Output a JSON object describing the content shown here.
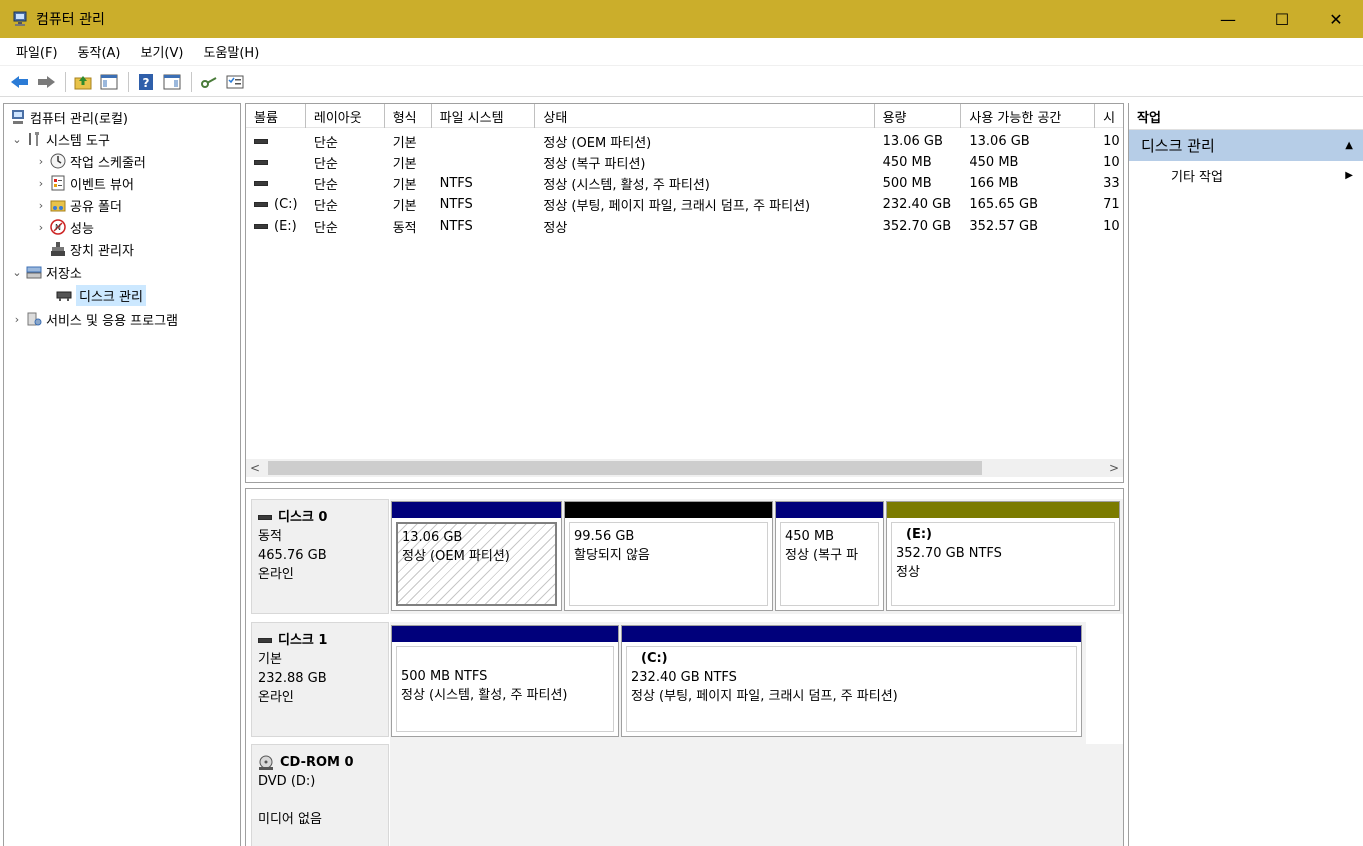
{
  "window": {
    "title": "컴퓨터 관리",
    "minimize": "—",
    "maximize": "☐",
    "close": "✕"
  },
  "menu": [
    "파일(F)",
    "동작(A)",
    "보기(V)",
    "도움말(H)"
  ],
  "tree": {
    "root": "컴퓨터 관리(로컬)",
    "system_tools": "시스템 도구",
    "task_scheduler": "작업 스케줄러",
    "event_viewer": "이벤트 뷰어",
    "shared_folders": "공유 폴더",
    "performance": "성능",
    "device_manager": "장치 관리자",
    "storage": "저장소",
    "disk_management": "디스크 관리",
    "services_apps": "서비스 및 응용 프로그램"
  },
  "volumes": {
    "columns": [
      "볼륨",
      "레이아웃",
      "형식",
      "파일 시스템",
      "상태",
      "용량",
      "사용 가능한 공간",
      "시"
    ],
    "rows": [
      {
        "volume": "",
        "layout": "단순",
        "type": "기본",
        "fs": "",
        "status": "정상 (OEM 파티션)",
        "capacity": "13.06 GB",
        "free": "13.06 GB",
        "pct": "10"
      },
      {
        "volume": "",
        "layout": "단순",
        "type": "기본",
        "fs": "",
        "status": "정상 (복구 파티션)",
        "capacity": "450 MB",
        "free": "450 MB",
        "pct": "10"
      },
      {
        "volume": "",
        "layout": "단순",
        "type": "기본",
        "fs": "NTFS",
        "status": "정상 (시스템, 활성, 주 파티션)",
        "capacity": "500 MB",
        "free": "166 MB",
        "pct": "33"
      },
      {
        "volume": "(C:)",
        "layout": "단순",
        "type": "기본",
        "fs": "NTFS",
        "status": "정상 (부팅, 페이지 파일, 크래시 덤프, 주 파티션)",
        "capacity": "232.40 GB",
        "free": "165.65 GB",
        "pct": "71"
      },
      {
        "volume": "(E:)",
        "layout": "단순",
        "type": "동적",
        "fs": "NTFS",
        "status": "정상",
        "capacity": "352.70 GB",
        "free": "352.57 GB",
        "pct": "10"
      }
    ]
  },
  "disks": {
    "disk0": {
      "name": "디스크 0",
      "kind": "동적",
      "size": "465.76 GB",
      "state": "온라인",
      "parts": [
        {
          "line1": "13.06 GB",
          "line2": "정상 (OEM 파티션)",
          "bar": "#00007b"
        },
        {
          "line1": "99.56 GB",
          "line2": "할당되지 않음",
          "bar": "#000000"
        },
        {
          "line1": "450 MB",
          "line2": "정상 (복구 파",
          "bar": "#00007b"
        },
        {
          "vol": "(E:)",
          "line1": "352.70 GB NTFS",
          "line2": "정상",
          "bar": "#7b7b00"
        }
      ]
    },
    "disk1": {
      "name": "디스크 1",
      "kind": "기본",
      "size": "232.88 GB",
      "state": "온라인",
      "parts": [
        {
          "line1": "500 MB NTFS",
          "line2": "정상 (시스템, 활성, 주 파티션)",
          "bar": "#00007b"
        },
        {
          "vol": "(C:)",
          "line1": "232.40 GB NTFS",
          "line2": "정상 (부팅, 페이지 파일, 크래시 덤프, 주 파티션)",
          "bar": "#00007b"
        }
      ]
    },
    "cdrom": {
      "name": "CD-ROM 0",
      "kind": "DVD (D:)",
      "state": "미디어 없음"
    }
  },
  "actions": {
    "header": "작업",
    "section": "디스크 관리",
    "more": "기타 작업"
  }
}
